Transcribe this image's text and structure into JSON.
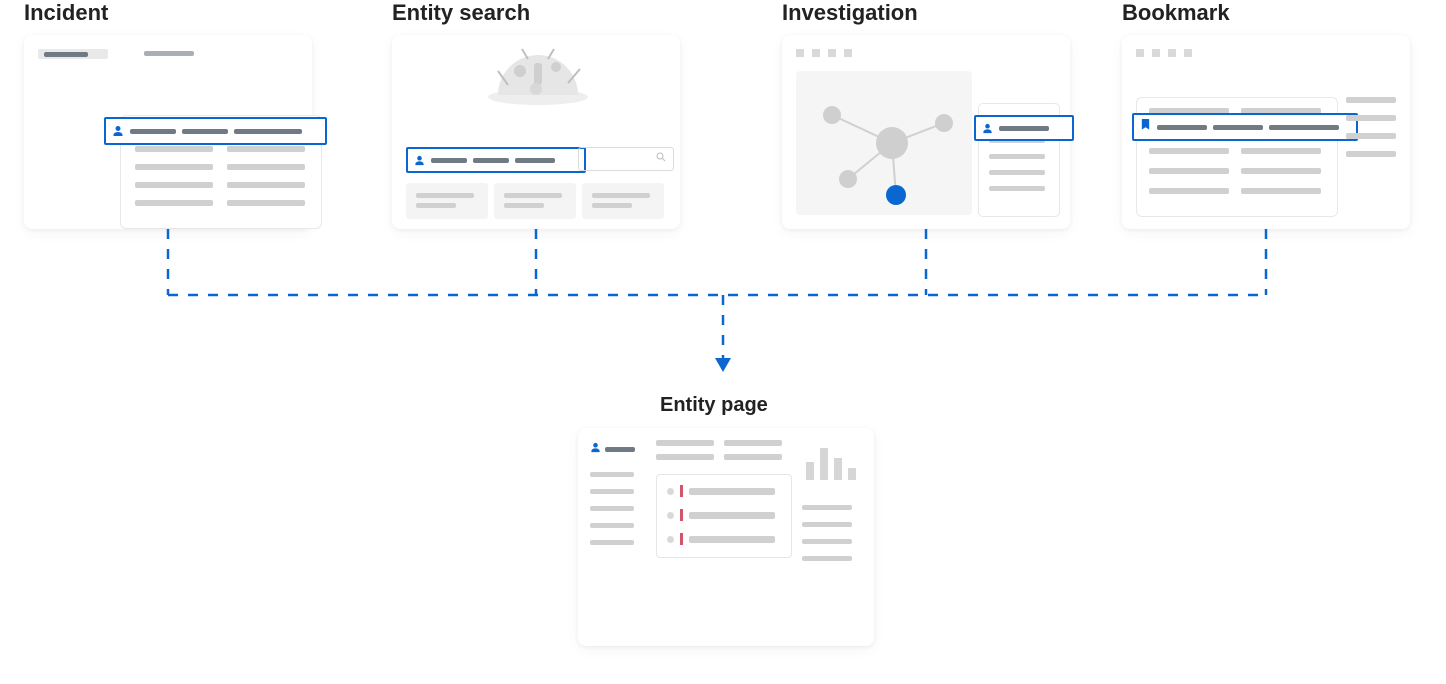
{
  "sources": {
    "incident": {
      "label": "Incident"
    },
    "entity_search": {
      "label": "Entity search"
    },
    "investigation": {
      "label": "Investigation"
    },
    "bookmark": {
      "label": "Bookmark"
    }
  },
  "target": {
    "entity_page": {
      "label": "Entity page"
    }
  },
  "colors": {
    "accent": "#0a67d1",
    "muted": "#d0d0d0",
    "muted_dark": "#6f7a84",
    "alert": "#d0566b"
  }
}
